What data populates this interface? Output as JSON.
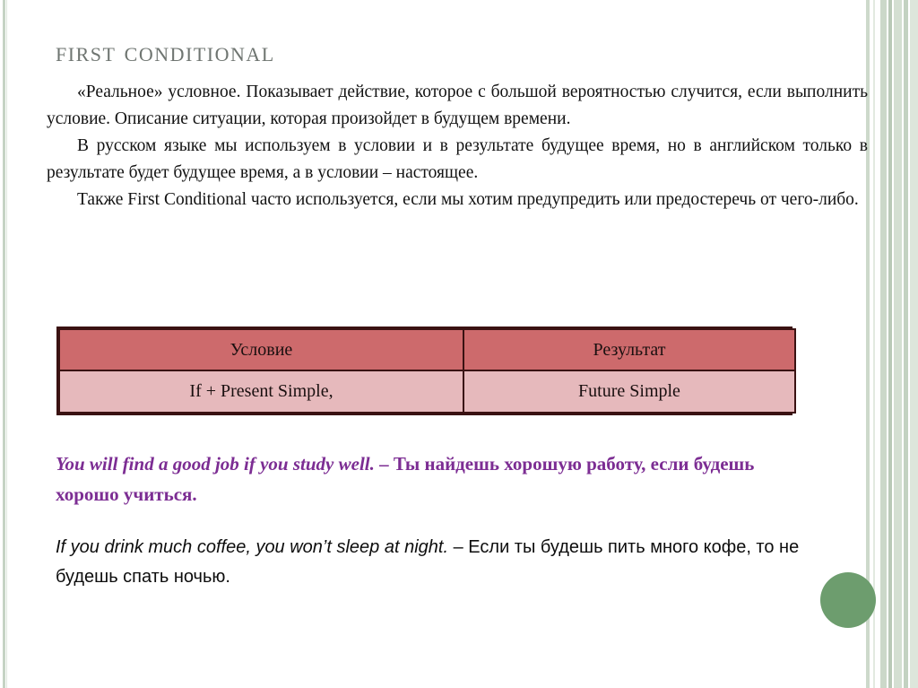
{
  "slide": {
    "title": "First Conditional",
    "title_color": "#6f7571",
    "background": "#ffffff"
  },
  "body": {
    "paragraphs": [
      "«Реальное» условное. Показывает действие, которое с большой вероятностью случится, если выполнить условие. Описание ситуации, которая произойдет в будущем времени.",
      "В русском языке мы используем в условии и в результате будущее время, но в английском только в результате будет будущее время, а в условии – настоящее.",
      "Также First Conditional часто используется, если мы хотим предупредить или предостеречь от чего-либо."
    ]
  },
  "table": {
    "header_color": "#cd6a6c",
    "body_color": "#e6b9bc",
    "border_color": "#3a1212",
    "headers": [
      "Условие",
      "Результат"
    ],
    "rows": [
      [
        "If + Present Simple,",
        "Future Simple"
      ]
    ]
  },
  "examples": [
    {
      "color": "#7c2d93",
      "english": "You will find a good job if you study well.",
      "dash": " – ",
      "russian": "Ты найдешь хорошую работу, если будешь хорошо учиться."
    },
    {
      "color": "#0d0d0d",
      "english": "If you drink much coffee, you won’t sleep at night.",
      "dash": " – ",
      "russian": "Если ты будешь пить много кофе, то не будешь спать ночью."
    }
  ],
  "decor": {
    "circle_color": "#6d9d6e",
    "stripe_color": "#c5d3c4"
  }
}
